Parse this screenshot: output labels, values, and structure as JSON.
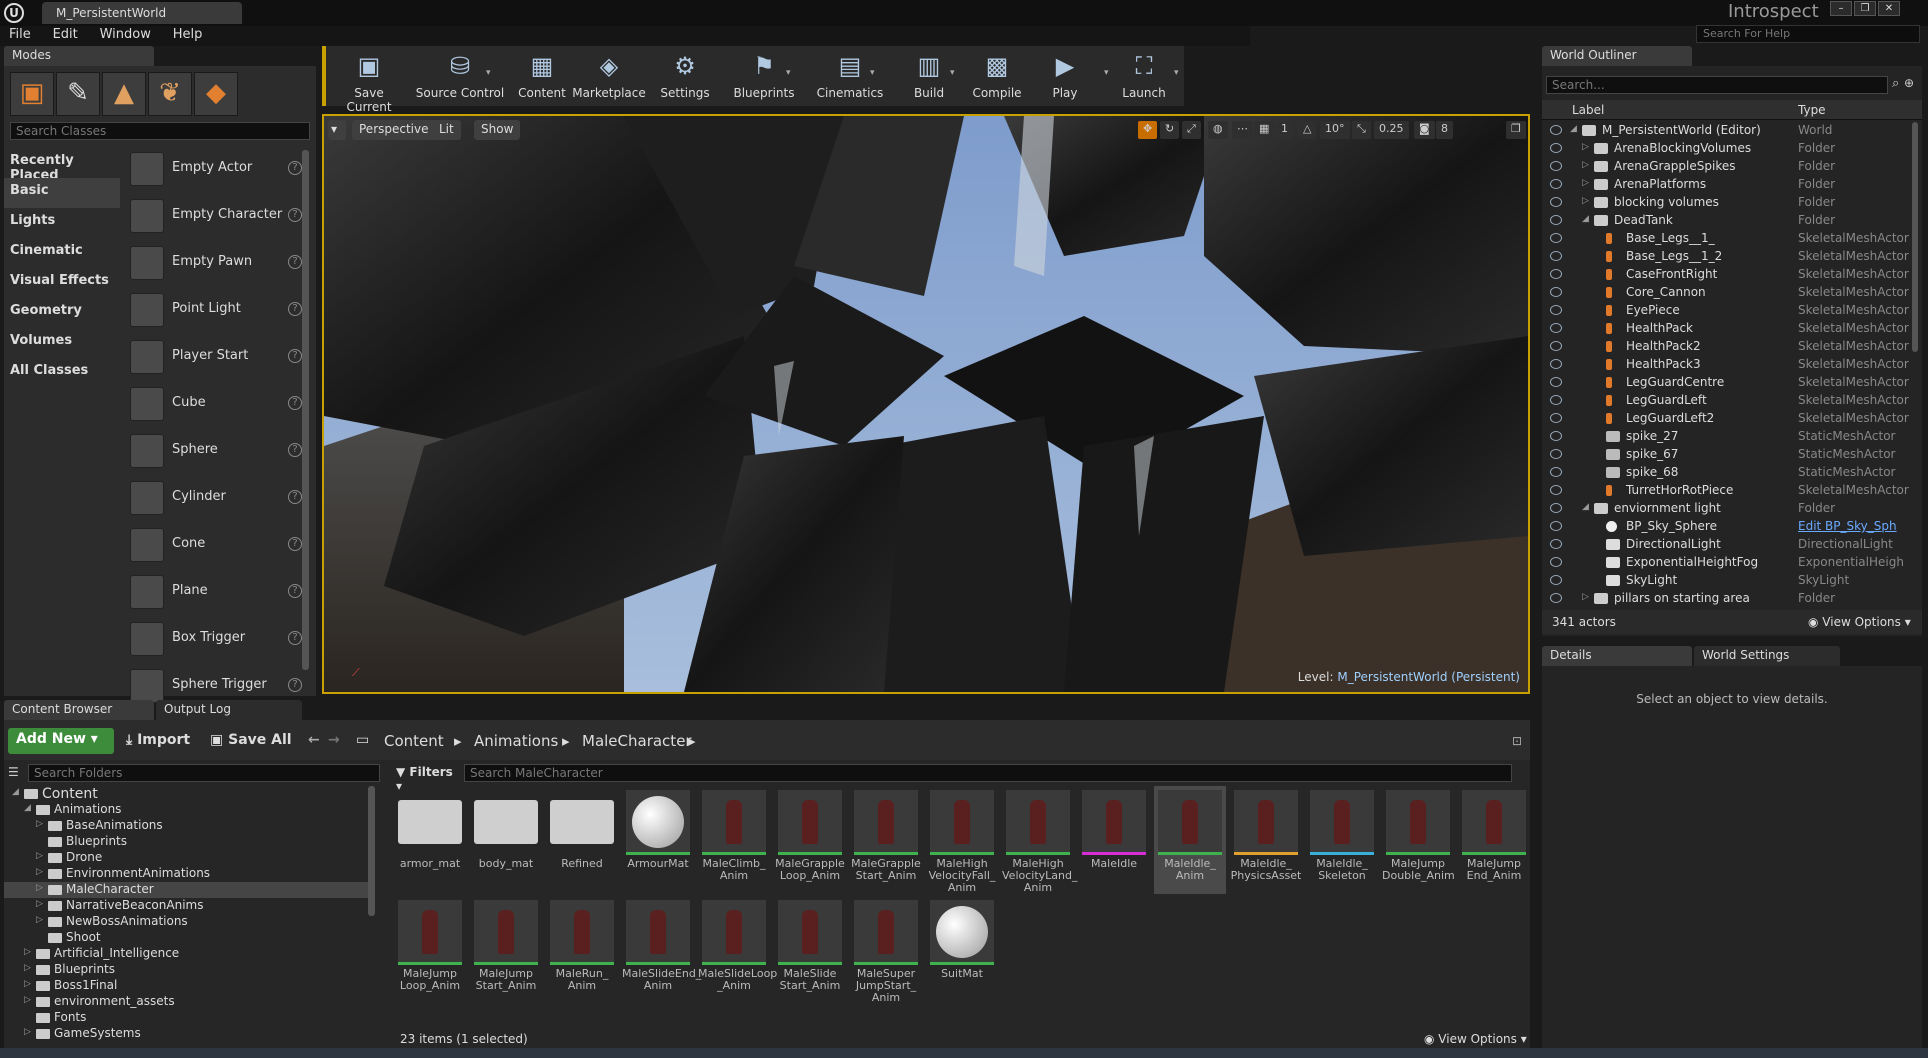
{
  "window": {
    "doc_tab": "M_PersistentWorld",
    "project": "Introspect",
    "help_search_placeholder": "Search For Help"
  },
  "menu": [
    "File",
    "Edit",
    "Window",
    "Help"
  ],
  "modes": {
    "tab": "Modes",
    "search_placeholder": "Search Classes",
    "categories": [
      "Recently Placed",
      "Basic",
      "Lights",
      "Cinematic",
      "Visual Effects",
      "Geometry",
      "Volumes",
      "All Classes"
    ],
    "classes": [
      "Empty Actor",
      "Empty Character",
      "Empty Pawn",
      "Point Light",
      "Player Start",
      "Cube",
      "Sphere",
      "Cylinder",
      "Cone",
      "Plane",
      "Box Trigger",
      "Sphere Trigger"
    ]
  },
  "toolbar": [
    {
      "label": "Save Current",
      "icon": "save-icon",
      "glyph": "▣"
    },
    {
      "label": "Source Control",
      "icon": "source-control-icon",
      "glyph": "⛁"
    },
    {
      "label": "Content",
      "icon": "content-icon",
      "glyph": "▦"
    },
    {
      "label": "Marketplace",
      "icon": "marketplace-icon",
      "glyph": "◈"
    },
    {
      "label": "Settings",
      "icon": "settings-icon",
      "glyph": "⚙"
    },
    {
      "label": "Blueprints",
      "icon": "blueprints-icon",
      "glyph": "⚑"
    },
    {
      "label": "Cinematics",
      "icon": "cinematics-icon",
      "glyph": "▤"
    },
    {
      "label": "Build",
      "icon": "build-icon",
      "glyph": "▥"
    },
    {
      "label": "Compile",
      "icon": "compile-icon",
      "glyph": "▩"
    },
    {
      "label": "Play",
      "icon": "play-icon",
      "glyph": "▶"
    },
    {
      "label": "Launch",
      "icon": "launch-icon",
      "glyph": "⛶"
    }
  ],
  "viewport": {
    "perspective": "Perspective",
    "lit": "Lit",
    "show": "Show",
    "grid_angle": "10°",
    "scale": "0.25",
    "camera_speed": "8",
    "level_label": "Level:",
    "level_name": "M_PersistentWorld (Persistent)"
  },
  "outliner": {
    "tab": "World Outliner",
    "search_placeholder": "Search...",
    "col_label": "Label",
    "col_type": "Type",
    "rows": [
      {
        "label": "M_PersistentWorld (Editor)",
        "type": "World",
        "indent": 0,
        "expand": "◢",
        "kind": "world"
      },
      {
        "label": "ArenaBlockingVolumes",
        "type": "Folder",
        "indent": 1,
        "expand": "▷",
        "kind": "folder"
      },
      {
        "label": "ArenaGrappleSpikes",
        "type": "Folder",
        "indent": 1,
        "expand": "▷",
        "kind": "folder"
      },
      {
        "label": "ArenaPlatforms",
        "type": "Folder",
        "indent": 1,
        "expand": "▷",
        "kind": "folder"
      },
      {
        "label": "blocking volumes",
        "type": "Folder",
        "indent": 1,
        "expand": "▷",
        "kind": "folder"
      },
      {
        "label": "DeadTank",
        "type": "Folder",
        "indent": 1,
        "expand": "◢",
        "kind": "folder"
      },
      {
        "label": "Base_Legs__1_",
        "type": "SkeletalMeshActor",
        "indent": 2,
        "expand": "",
        "kind": "mesh"
      },
      {
        "label": "Base_Legs__1_2",
        "type": "SkeletalMeshActor",
        "indent": 2,
        "expand": "",
        "kind": "mesh"
      },
      {
        "label": "CaseFrontRight",
        "type": "SkeletalMeshActor",
        "indent": 2,
        "expand": "",
        "kind": "mesh"
      },
      {
        "label": "Core_Cannon",
        "type": "SkeletalMeshActor",
        "indent": 2,
        "expand": "",
        "kind": "mesh"
      },
      {
        "label": "EyePiece",
        "type": "SkeletalMeshActor",
        "indent": 2,
        "expand": "",
        "kind": "mesh"
      },
      {
        "label": "HealthPack",
        "type": "SkeletalMeshActor",
        "indent": 2,
        "expand": "",
        "kind": "mesh"
      },
      {
        "label": "HealthPack2",
        "type": "SkeletalMeshActor",
        "indent": 2,
        "expand": "",
        "kind": "mesh"
      },
      {
        "label": "HealthPack3",
        "type": "SkeletalMeshActor",
        "indent": 2,
        "expand": "",
        "kind": "mesh"
      },
      {
        "label": "LegGuardCentre",
        "type": "SkeletalMeshActor",
        "indent": 2,
        "expand": "",
        "kind": "mesh"
      },
      {
        "label": "LegGuardLeft",
        "type": "SkeletalMeshActor",
        "indent": 2,
        "expand": "",
        "kind": "mesh"
      },
      {
        "label": "LegGuardLeft2",
        "type": "SkeletalMeshActor",
        "indent": 2,
        "expand": "",
        "kind": "mesh"
      },
      {
        "label": "spike_27",
        "type": "StaticMeshActor",
        "indent": 2,
        "expand": "",
        "kind": "static"
      },
      {
        "label": "spike_67",
        "type": "StaticMeshActor",
        "indent": 2,
        "expand": "",
        "kind": "static"
      },
      {
        "label": "spike_68",
        "type": "StaticMeshActor",
        "indent": 2,
        "expand": "",
        "kind": "static"
      },
      {
        "label": "TurretHorRotPiece",
        "type": "SkeletalMeshActor",
        "indent": 2,
        "expand": "",
        "kind": "mesh"
      },
      {
        "label": "enviornment light",
        "type": "Folder",
        "indent": 1,
        "expand": "◢",
        "kind": "folder"
      },
      {
        "label": "BP_Sky_Sphere",
        "type": "Edit BP_Sky_Sph",
        "indent": 2,
        "expand": "",
        "kind": "sphere",
        "link": true
      },
      {
        "label": "DirectionalLight",
        "type": "DirectionalLight",
        "indent": 2,
        "expand": "",
        "kind": "light"
      },
      {
        "label": "ExponentialHeightFog",
        "type": "ExponentialHeigh",
        "indent": 2,
        "expand": "",
        "kind": "fog"
      },
      {
        "label": "SkyLight",
        "type": "SkyLight",
        "indent": 2,
        "expand": "",
        "kind": "light"
      },
      {
        "label": "pillars on starting area",
        "type": "Folder",
        "indent": 1,
        "expand": "▷",
        "kind": "folder"
      }
    ],
    "actor_count": "341 actors",
    "view_options": "View Options"
  },
  "details": {
    "tab": "Details",
    "world_settings_tab": "World Settings",
    "empty_message": "Select an object to view details."
  },
  "content_browser": {
    "tab": "Content Browser",
    "output_log_tab": "Output Log",
    "add_new": "Add New",
    "import": "Import",
    "save_all": "Save All",
    "breadcrumbs": [
      "Content",
      "Animations",
      "MaleCharacter"
    ],
    "folder_search_placeholder": "Search Folders",
    "filters": "Filters",
    "asset_search_placeholder": "Search MaleCharacter",
    "tree": [
      {
        "label": "Content",
        "indent": 0,
        "expand": "◢",
        "root": true
      },
      {
        "label": "Animations",
        "indent": 1,
        "expand": "◢"
      },
      {
        "label": "BaseAnimations",
        "indent": 2,
        "expand": "▷"
      },
      {
        "label": "Blueprints",
        "indent": 2,
        "expand": ""
      },
      {
        "label": "Drone",
        "indent": 2,
        "expand": "▷"
      },
      {
        "label": "EnvironmentAnimations",
        "indent": 2,
        "expand": "▷"
      },
      {
        "label": "MaleCharacter",
        "indent": 2,
        "expand": "▷",
        "selected": true
      },
      {
        "label": "NarrativeBeaconAnims",
        "indent": 2,
        "expand": "▷"
      },
      {
        "label": "NewBossAnimations",
        "indent": 2,
        "expand": "▷"
      },
      {
        "label": "Shoot",
        "indent": 2,
        "expand": ""
      },
      {
        "label": "Artificial_Intelligence",
        "indent": 1,
        "expand": "▷"
      },
      {
        "label": "Blueprints",
        "indent": 1,
        "expand": "▷"
      },
      {
        "label": "Boss1Final",
        "indent": 1,
        "expand": "▷"
      },
      {
        "label": "environment_assets",
        "indent": 1,
        "expand": "▷"
      },
      {
        "label": "Fonts",
        "indent": 1,
        "expand": ""
      },
      {
        "label": "GameSystems",
        "indent": 1,
        "expand": "▷"
      }
    ],
    "assets": [
      {
        "name": "armor_mat",
        "kind": "folder",
        "stripe": ""
      },
      {
        "name": "body_mat",
        "kind": "folder",
        "stripe": ""
      },
      {
        "name": "Refined",
        "kind": "folder",
        "stripe": ""
      },
      {
        "name": "ArmourMat",
        "kind": "sphere",
        "stripe": "#3fb24f"
      },
      {
        "name": "MaleClimb_ Anim",
        "kind": "char",
        "stripe": "#3fb24f"
      },
      {
        "name": "MaleGrapple Loop_Anim",
        "kind": "char",
        "stripe": "#3fb24f"
      },
      {
        "name": "MaleGrapple Start_Anim",
        "kind": "char",
        "stripe": "#3fb24f"
      },
      {
        "name": "MaleHigh VelocityFall_ Anim",
        "kind": "char",
        "stripe": "#3fb24f"
      },
      {
        "name": "MaleHigh VelocityLand_ Anim",
        "kind": "char",
        "stripe": "#3fb24f"
      },
      {
        "name": "MaleIdle",
        "kind": "char",
        "stripe": "#d42ed4"
      },
      {
        "name": "MaleIdle_ Anim",
        "kind": "char",
        "stripe": "#3fb24f",
        "selected": true
      },
      {
        "name": "MaleIdle_ PhysicsAsset",
        "kind": "char",
        "stripe": "#e0a030"
      },
      {
        "name": "MaleIdle_ Skeleton",
        "kind": "char",
        "stripe": "#3ab0d8"
      },
      {
        "name": "MaleJump Double_Anim",
        "kind": "char",
        "stripe": "#3fb24f"
      },
      {
        "name": "MaleJump End_Anim",
        "kind": "char",
        "stripe": "#3fb24f"
      },
      {
        "name": "MaleJump Loop_Anim",
        "kind": "char",
        "stripe": "#3fb24f"
      },
      {
        "name": "MaleJump Start_Anim",
        "kind": "char",
        "stripe": "#3fb24f"
      },
      {
        "name": "MaleRun_ Anim",
        "kind": "char",
        "stripe": "#3fb24f"
      },
      {
        "name": "MaleSlideEnd_ Anim",
        "kind": "char",
        "stripe": "#3fb24f"
      },
      {
        "name": "MaleSlideLoop _Anim",
        "kind": "char",
        "stripe": "#3fb24f"
      },
      {
        "name": "MaleSlide Start_Anim",
        "kind": "char",
        "stripe": "#3fb24f"
      },
      {
        "name": "MaleSuper JumpStart_ Anim",
        "kind": "char",
        "stripe": "#3fb24f"
      },
      {
        "name": "SuitMat",
        "kind": "sphere",
        "stripe": "#3fb24f"
      }
    ],
    "status": "23 items (1 selected)",
    "view_options": "View Options"
  }
}
